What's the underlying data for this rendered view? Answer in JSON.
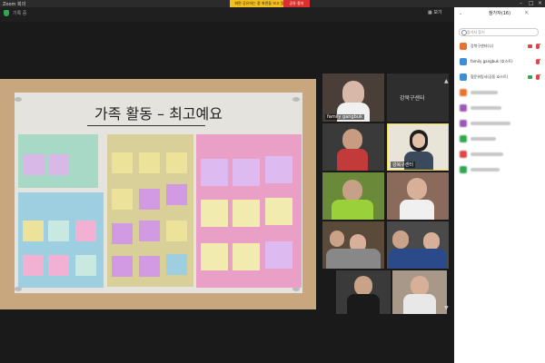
{
  "window": {
    "app_name": "Zoom 회의",
    "recording_label": "기록 중"
  },
  "share_banner": {
    "text": "화면 공유하는 중 화면을 보고 있습니다",
    "stop_label": "공유 중지"
  },
  "toolbar": {
    "view_label": "보기"
  },
  "slide": {
    "title": "가족 활동 – 최고예요"
  },
  "gallery": {
    "tiles": [
      {
        "name": "family gangbuk",
        "type": "video"
      },
      {
        "name": "강북구센터",
        "type": "name_only"
      },
      {
        "name": "",
        "type": "video"
      },
      {
        "name": "강북구센터",
        "type": "video"
      },
      {
        "name": "",
        "type": "video"
      },
      {
        "name": "",
        "type": "video"
      },
      {
        "name": "",
        "type": "video"
      },
      {
        "name": "",
        "type": "video"
      },
      {
        "name": "",
        "type": "video"
      },
      {
        "name": "",
        "type": "video"
      },
      {
        "name": "",
        "type": "video"
      }
    ]
  },
  "participants": {
    "title": "참가자(16)",
    "search_placeholder": "참가자 찾기",
    "list": [
      {
        "name": "강북구센터(나)",
        "avatar_color": "#e8732c"
      },
      {
        "name": "family gangbuk (호스트)",
        "avatar_color": "#3a8fd6"
      },
      {
        "name": "협운워킹사(공동 호스트)",
        "avatar_color": "#3a8fd6"
      },
      {
        "name": "",
        "avatar_color": "#e8732c"
      },
      {
        "name": "",
        "avatar_color": "#9b59b6"
      },
      {
        "name": "",
        "avatar_color": "#9b59b6"
      },
      {
        "name": "",
        "avatar_color": "#2fa84f"
      },
      {
        "name": "",
        "avatar_color": "#e04646"
      },
      {
        "name": "",
        "avatar_color": "#2fa84f"
      }
    ]
  },
  "colors": {
    "banner": "#f4c020",
    "stop": "#d93030",
    "board": "#c9a77e",
    "panel": "#ffffff"
  }
}
